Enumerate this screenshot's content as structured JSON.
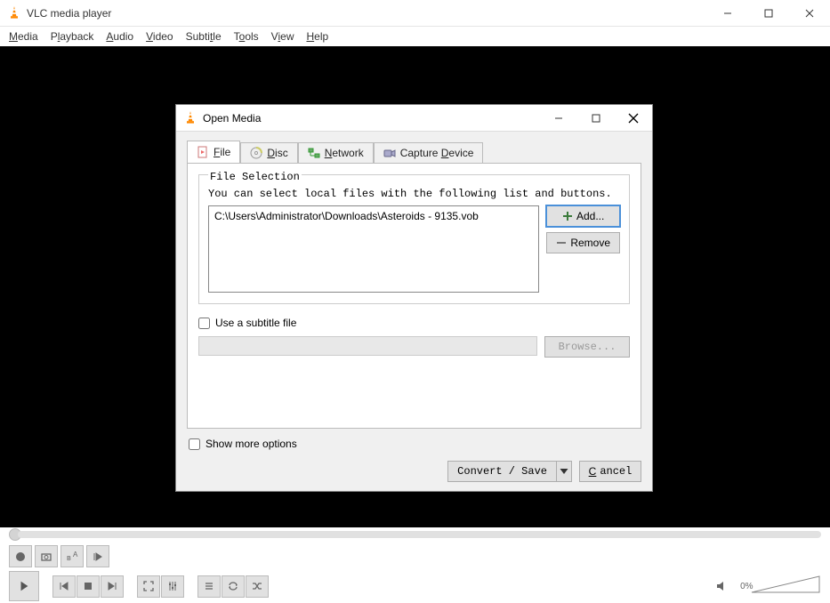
{
  "window": {
    "title": "VLC media player"
  },
  "menubar": {
    "media": "Media",
    "playback": "Playback",
    "audio": "Audio",
    "video": "Video",
    "subtitle": "Subtitle",
    "tools": "Tools",
    "view": "View",
    "help": "Help"
  },
  "volume": {
    "percent": "0%"
  },
  "dialog": {
    "title": "Open Media",
    "tabs": {
      "file": "File",
      "disc": "Disc",
      "network": "Network",
      "capture": "Capture Device"
    },
    "fileSelection": {
      "legend": "File Selection",
      "hint": "You can select local files with the following list and buttons.",
      "files": [
        "C:\\Users\\Administrator\\Downloads\\Asteroids - 9135.vob"
      ],
      "addLabel": "Add...",
      "removeLabel": "Remove"
    },
    "subtitle": {
      "checkboxLabel": "Use a subtitle file",
      "browseLabel": "Browse..."
    },
    "moreOptionsLabel": "Show more options",
    "footer": {
      "convertSave": "Convert / Save",
      "cancel": "Cancel"
    }
  }
}
